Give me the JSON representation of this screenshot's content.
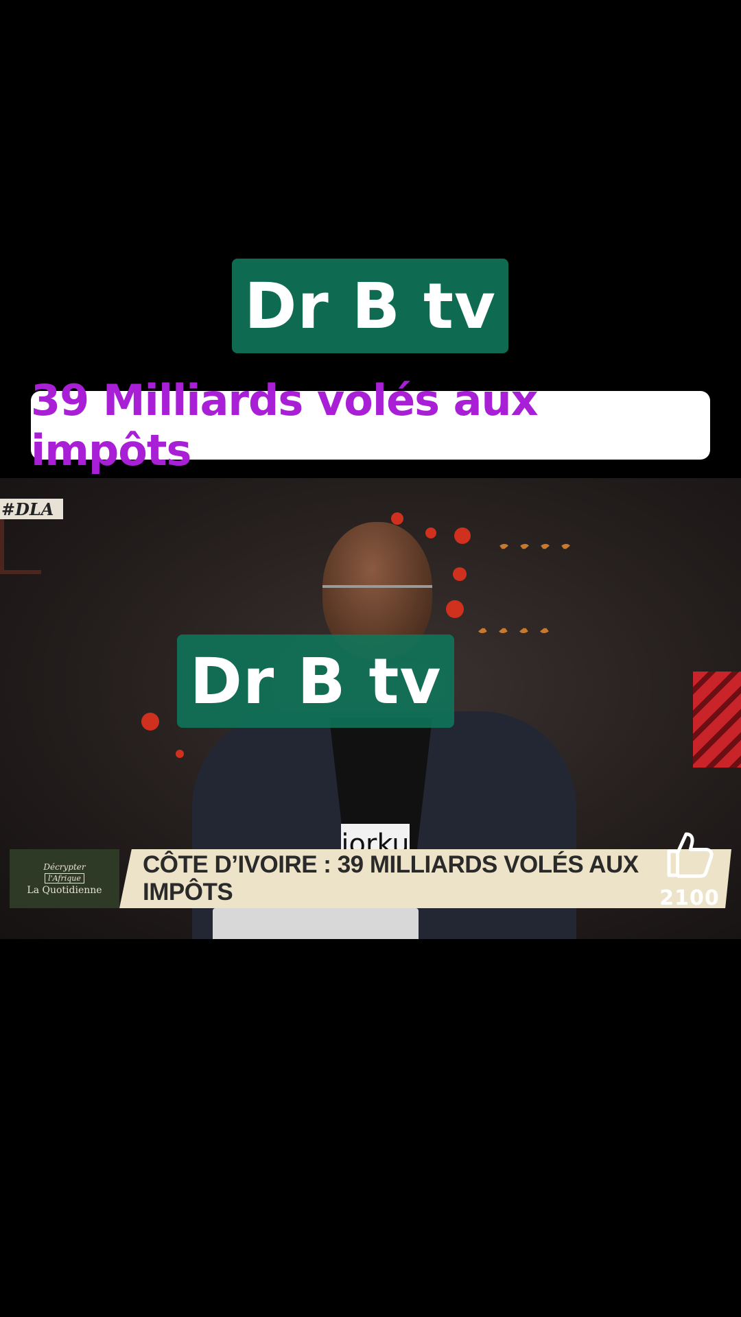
{
  "channel_badge_top": {
    "label": "Dr B tv"
  },
  "headline": {
    "text": "39 Milliards volés aux impôts"
  },
  "video": {
    "tag": "#DLA",
    "channel_badge_mid": {
      "label": "Dr B tv"
    },
    "shirt_text": "jorku",
    "lower_third": {
      "logo_line1": "Décrypter",
      "logo_line2": "l'Afrique",
      "logo_line3": "La Quotidienne",
      "title": "CÔTE D’IVOIRE : 39 MILLIARDS VOLÉS AUX IMPÔTS"
    }
  },
  "like": {
    "icon": "thumbs-up-icon",
    "count": "2100"
  },
  "colors": {
    "badge_green": "#0e6b52",
    "headline_purple": "#a81fd6",
    "lower_third_bg": "#ede3c8"
  }
}
